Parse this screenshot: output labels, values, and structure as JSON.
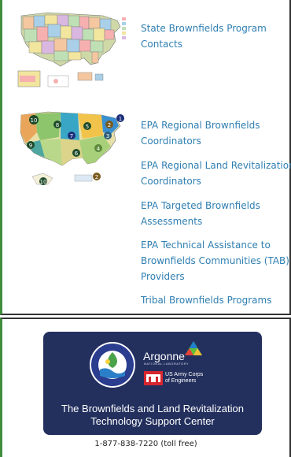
{
  "links": {
    "state_contacts": [
      "State Brownfields Program",
      "Contacts"
    ],
    "regional_coordinators": [
      "EPA Regional Brownfields",
      "Coordinators"
    ],
    "land_revitalization": [
      "EPA Regional Land Revitalization",
      "Coordinators"
    ],
    "targeted_assessments": [
      "EPA Targeted Brownfields",
      "Assessments"
    ],
    "tab_providers": [
      "EPA Technical Assistance to",
      "Brownfields Communities (TAB)",
      "Providers"
    ],
    "tribal": [
      "Tribal Brownfields Programs"
    ]
  },
  "logos": {
    "argonne": "Argonne",
    "argonne_sub": "NATIONAL LABORATORY",
    "usace": [
      "US Army Corps",
      "of Engineers"
    ],
    "epa_seal_text": "UNITED STATES · ENVIRONMENTAL PROTECTION AGENCY"
  },
  "tsc": {
    "title": [
      "The Brownfields and Land Revitalization",
      "Technology Support Center"
    ]
  },
  "contact": {
    "phone": "1-877-838-7220 (toll free)"
  },
  "map_regions": [
    "10",
    "8",
    "5",
    "2",
    "1",
    "7",
    "3",
    "4",
    "6",
    "9"
  ],
  "colors": {
    "link": "#2f7fb2",
    "tsc_card": "#23305e",
    "panel_accent": "#3e8e3e"
  }
}
